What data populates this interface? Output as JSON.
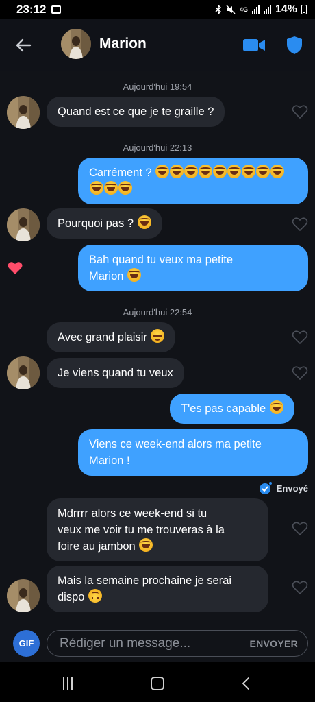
{
  "status_bar": {
    "time": "23:12",
    "network": "4G",
    "battery": "14%"
  },
  "header": {
    "contact_name": "Marion",
    "back_icon": "arrow-left-icon",
    "video_icon": "video-camera-icon",
    "safety_icon": "shield-icon"
  },
  "conversation": {
    "timestamps": [
      "Aujourd'hui 19:54",
      "Aujourd'hui 22:13",
      "Aujourd'hui 22:54"
    ],
    "messages": [
      {
        "from": "them",
        "text": "Quand est ce que je te graille ?"
      },
      {
        "from": "me",
        "text": "Carrément ?",
        "emoji": "rolling-on-floor-laughing x12"
      },
      {
        "from": "them",
        "text": "Pourquoi pas ?",
        "emoji": "tears-of-joy"
      },
      {
        "from": "me",
        "text_line1": "Bah quand tu veux ma petite",
        "text_line2": "Marion",
        "emoji": "rolling-on-floor-laughing",
        "liked": true
      },
      {
        "from": "them",
        "text": "Avec grand plaisir",
        "emoji": "relieved-face"
      },
      {
        "from": "them",
        "text": "Je viens quand tu veux"
      },
      {
        "from": "me",
        "text": "T'es pas capable",
        "emoji": "rolling-on-floor-laughing"
      },
      {
        "from": "me",
        "text_line1": "Viens ce week-end alors ma petite",
        "text_line2": "Marion !"
      },
      {
        "from": "them",
        "text_line1": "Mdrrrr alors ce week-end si tu",
        "text_line2": "veux me voir tu me trouveras à la",
        "text_line3": "foire au jambon",
        "emoji": "tears-of-joy"
      },
      {
        "from": "them",
        "text_line1": "Mais la semaine prochaine je serai",
        "text_line2": "dispo",
        "emoji": "upside-down-face"
      }
    ],
    "delivery_status": "Envoyé"
  },
  "composer": {
    "gif_label": "GIF",
    "placeholder": "Rédiger un message...",
    "send_label": "ENVOYER"
  },
  "colors": {
    "sent_bubble": "#3fa1ff",
    "received_bubble": "#25282f",
    "background": "#111318",
    "accent": "#2d6fd6",
    "liked_heart": "#ff4d6a"
  }
}
